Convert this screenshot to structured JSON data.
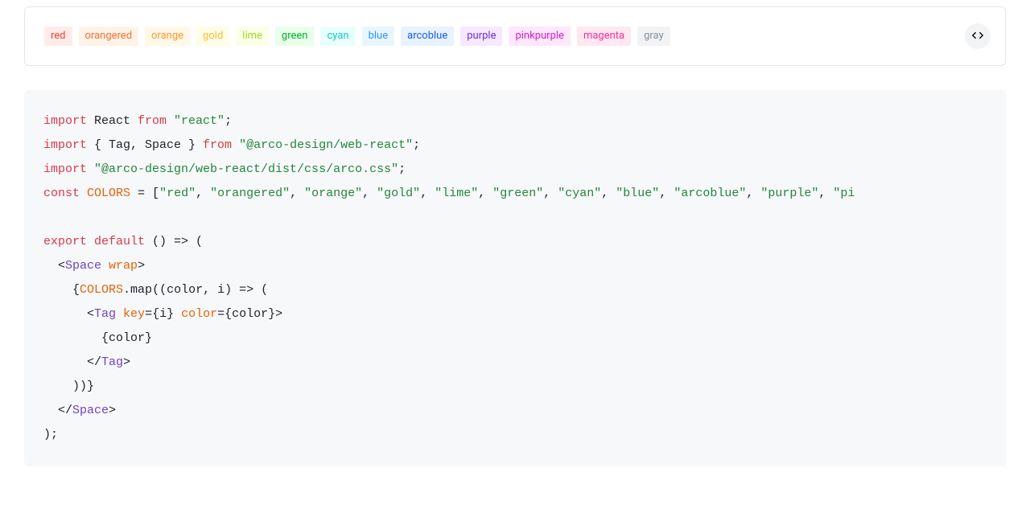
{
  "tags": [
    {
      "label": "red",
      "bg": "#ffece8",
      "fg": "#f53f3f"
    },
    {
      "label": "orangered",
      "bg": "#fff3e8",
      "fg": "#f77234"
    },
    {
      "label": "orange",
      "bg": "#fff7e8",
      "fg": "#ff9a2e"
    },
    {
      "label": "gold",
      "bg": "#fffce8",
      "fg": "#f7c034"
    },
    {
      "label": "lime",
      "bg": "#fcffe8",
      "fg": "#9fdb1d"
    },
    {
      "label": "green",
      "bg": "#e8ffea",
      "fg": "#00b42a"
    },
    {
      "label": "cyan",
      "bg": "#e8fffb",
      "fg": "#14c9c9"
    },
    {
      "label": "blue",
      "bg": "#e8f7ff",
      "fg": "#3491fa"
    },
    {
      "label": "arcoblue",
      "bg": "#e8f3ff",
      "fg": "#165dff"
    },
    {
      "label": "purple",
      "bg": "#f5e8ff",
      "fg": "#722ed1"
    },
    {
      "label": "pinkpurple",
      "bg": "#ffe8fb",
      "fg": "#d91ad9"
    },
    {
      "label": "magenta",
      "bg": "#ffe8f1",
      "fg": "#f5319d"
    },
    {
      "label": "gray",
      "bg": "#f2f3f5",
      "fg": "#86909c"
    }
  ],
  "icons": {
    "code_toggle": "code-icon"
  },
  "code": {
    "line1": {
      "kw_import": "import",
      "ident": " React ",
      "kw_from": "from",
      "str": " \"react\"",
      "semi": ";"
    },
    "line2": {
      "kw_import": "import",
      "braces": " { Tag, Space } ",
      "kw_from": "from",
      "str": " \"@arco-design/web-react\"",
      "semi": ";"
    },
    "line3": {
      "kw_import": "import",
      "str": " \"@arco-design/web-react/dist/css/arco.css\"",
      "semi": ";"
    },
    "line4": {
      "kw_const": "const",
      "sp": " ",
      "name": "COLORS",
      "eq": " = [",
      "s1": "\"red\"",
      "c1": ", ",
      "s2": "\"orangered\"",
      "c2": ", ",
      "s3": "\"orange\"",
      "c3": ", ",
      "s4": "\"gold\"",
      "c4": ", ",
      "s5": "\"lime\"",
      "c5": ", ",
      "s6": "\"green\"",
      "c6": ", ",
      "s7": "\"cyan\"",
      "c7": ", ",
      "s8": "\"blue\"",
      "c8": ", ",
      "s9": "\"arcoblue\"",
      "c9": ", ",
      "s10": "\"purple\"",
      "c10": ", ",
      "s11": "\"pi"
    },
    "line5": "",
    "line6": {
      "kw_export": "export",
      "sp1": " ",
      "kw_default": "default",
      "rest": " () => ("
    },
    "line7": {
      "indent": "  <",
      "tag": "Space",
      "sp": " ",
      "attr": "wrap",
      "close": ">"
    },
    "line8": {
      "indent": "    {",
      "name": "COLORS",
      "dot": ".",
      "fn": "map",
      "rest": "((color, i) => ("
    },
    "line9": {
      "indent": "      <",
      "tag": "Tag",
      "sp1": " ",
      "attr1": "key",
      "eq1": "={",
      "val1": "i",
      "close1": "} ",
      "attr2": "color",
      "eq2": "={",
      "val2": "color",
      "close2": "}>"
    },
    "line10": {
      "text": "        {color}"
    },
    "line11": {
      "indent": "      </",
      "tag": "Tag",
      "close": ">"
    },
    "line12": {
      "text": "    ))}"
    },
    "line13": {
      "indent": "  </",
      "tag": "Space",
      "close": ">"
    },
    "line14": {
      "text": ");"
    }
  }
}
